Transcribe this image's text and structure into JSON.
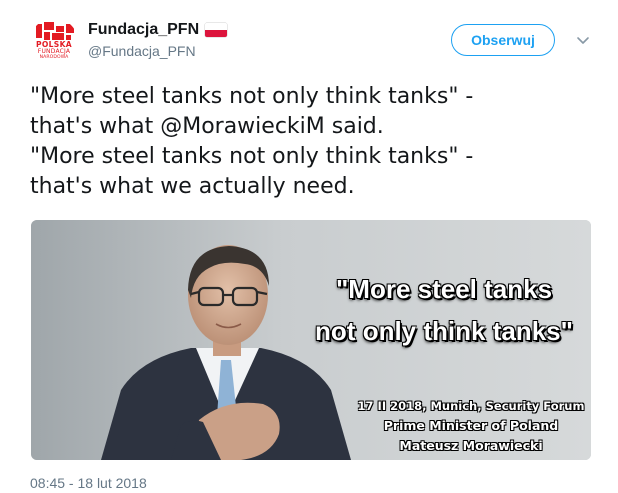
{
  "account": {
    "display_name": "Fundacja_PFN",
    "handle": "@Fundacja_PFN",
    "avatar_logo_lines": [
      "POLSKA",
      "FUNDACJA",
      "NARODOWA"
    ],
    "flag_icon": "poland-flag-icon"
  },
  "actions": {
    "follow_label": "Obserwuj",
    "more_icon": "chevron-down-icon"
  },
  "tweet": {
    "lines": [
      "\"More steel tanks not only think tanks\" -",
      "that's what @MorawieckiM said.",
      "\"More steel tanks not only think tanks\" -",
      "that's what we actually need."
    ]
  },
  "media": {
    "quote_lines": [
      "\"More steel tanks",
      "not only think tanks\""
    ],
    "caption_event": "17 II 2018, Munich, Security Forum",
    "caption_title": "Prime Minister of Poland",
    "caption_name": "Mateusz Morawiecki"
  },
  "timestamp": "08:45 - 18 lut 2018",
  "colors": {
    "accent": "#1da1f2",
    "text_primary": "#14171a",
    "text_secondary": "#657786",
    "logo_red": "#e31b23"
  }
}
